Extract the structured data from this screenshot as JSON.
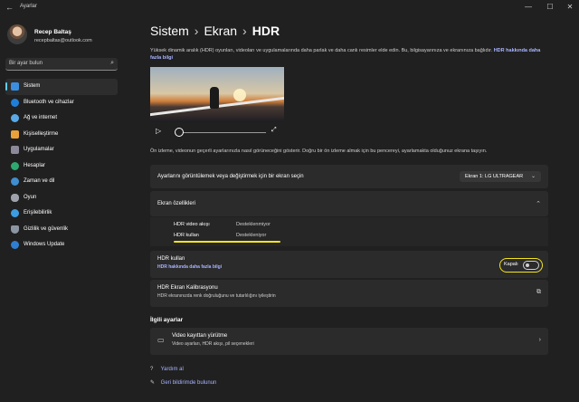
{
  "window": {
    "title": "Ayarlar",
    "back_icon": "←",
    "min_icon": "—",
    "max_icon": "☐",
    "close_icon": "✕"
  },
  "user": {
    "name": "Recep Baltaş",
    "email": "recepbaltas@outlook.com"
  },
  "search": {
    "placeholder": "Bir ayar bulun"
  },
  "sidebar": {
    "items": [
      {
        "label": "Sistem",
        "icon": "system-icon",
        "color": "#3b8fe0",
        "active": true
      },
      {
        "label": "Bluetooth ve cihazlar",
        "icon": "bluetooth-icon",
        "color": "#1f7fd8"
      },
      {
        "label": "Ağ ve internet",
        "icon": "network-icon",
        "color": "#5aa9e6"
      },
      {
        "label": "Kişiselleştirme",
        "icon": "brush-icon",
        "color": "#e8a13a"
      },
      {
        "label": "Uygulamalar",
        "icon": "apps-icon",
        "color": "#8a8a9a"
      },
      {
        "label": "Hesaplar",
        "icon": "accounts-icon",
        "color": "#2fa86f"
      },
      {
        "label": "Zaman ve dil",
        "icon": "globe-icon",
        "color": "#3e8ed0"
      },
      {
        "label": "Oyun",
        "icon": "gamepad-icon",
        "color": "#9ea3ab"
      },
      {
        "label": "Erişilebilirlik",
        "icon": "accessibility-icon",
        "color": "#3c9de0"
      },
      {
        "label": "Gizlilik ve güvenlik",
        "icon": "shield-icon",
        "color": "#8c96a3"
      },
      {
        "label": "Windows Update",
        "icon": "update-icon",
        "color": "#2f7ed0"
      }
    ]
  },
  "breadcrumb": {
    "first": "Sistem",
    "second": "Ekran",
    "current": "HDR",
    "sep": "›"
  },
  "description": {
    "text": "Yüksek dinamik aralık (HDR) oyunları, videoları ve uygulamalarında daha parlak ve daha canlı resimler elde edin. Bu, bilgisayarınıza ve ekranınıza bağlıdır. ",
    "link": "HDR hakkında daha fazla bilgi"
  },
  "preview": {
    "play_icon": "▷",
    "fullscreen_icon": "⤢"
  },
  "preview_note": "Ön izleme, videonun geçerli ayarlarınızla nasıl görüneceğini gösterir. Doğru bir ön izleme almak için bu pencereyi, ayarlamakta olduğunuz ekrana taşıyın.",
  "display_select": {
    "label": "Ayarlarını görüntülemek veya değiştirmek için bir ekran seçin",
    "value": "Ekran 1: LG ULTRAGEAR",
    "chevron": "⌄"
  },
  "properties": {
    "title": "Ekran özellikleri",
    "chevron": "⌃",
    "rows": [
      {
        "key": "HDR video akışı",
        "value": "Desteklenmiyor"
      },
      {
        "key": "HDR kullan",
        "value": "Destekleniyor"
      }
    ]
  },
  "use_hdr": {
    "title": "HDR kullan",
    "link": "HDR hakkında daha fazla bilgi",
    "toggle_label": "Kapalı",
    "state": "off"
  },
  "calibration": {
    "title": "HDR Ekran Kalibrasyonu",
    "subtitle": "HDR ekranınızda renk doğruluğunu ve tutarlılığını iyileştirin",
    "icon": "⧉"
  },
  "related": {
    "heading": "İlgili ayarlar",
    "video_playback": {
      "title": "Video kayıttan yürütme",
      "subtitle": "Video ayarları, HDR akışı, pil seçenekleri",
      "icon": "▭",
      "chevron": "›"
    }
  },
  "help": {
    "get_help": "Yardım al",
    "feedback": "Geri bildirimde bulunun",
    "help_icon": "?",
    "feedback_icon": "✎"
  },
  "colors": {
    "accent": "#60cdff",
    "highlight": "#f3e41d",
    "link": "#a8b4ff"
  }
}
